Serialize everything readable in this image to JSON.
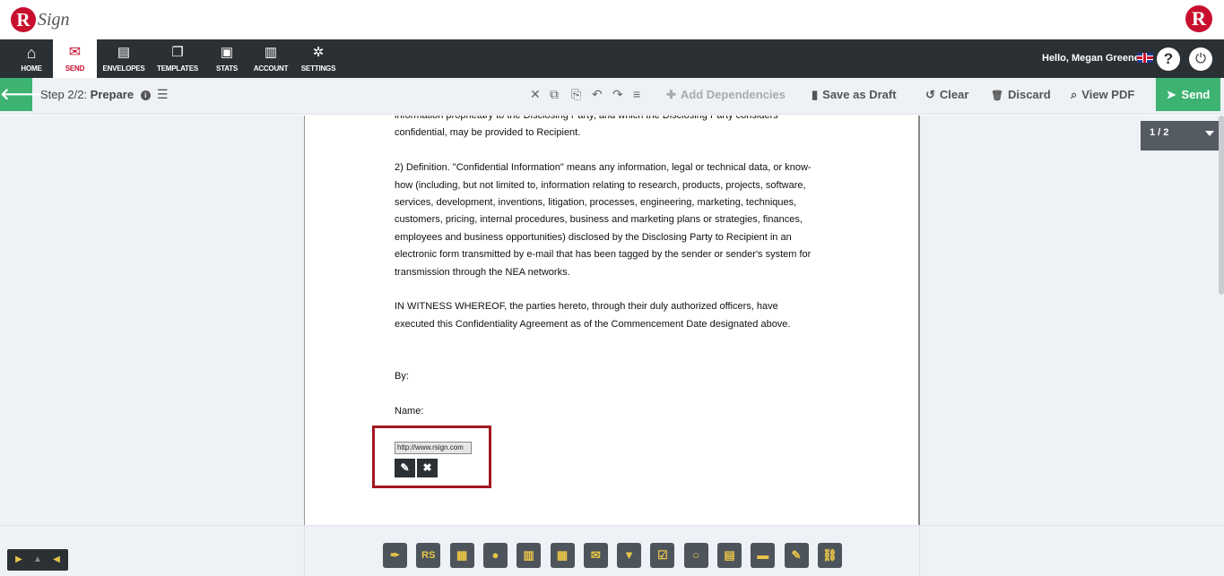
{
  "header": {
    "logo_r": "R",
    "logo_sign": "Sign",
    "brand_r": "R"
  },
  "nav": {
    "items": [
      {
        "label": "HOME",
        "icon": "home-icon",
        "glyph": "⌂"
      },
      {
        "label": "SEND",
        "icon": "envelope-icon",
        "glyph": "✉",
        "active": true
      },
      {
        "label": "ENVELOPES",
        "icon": "inbox-icon",
        "glyph": "▤"
      },
      {
        "label": "TEMPLATES",
        "icon": "copy-icon",
        "glyph": "❐"
      },
      {
        "label": "STATS",
        "icon": "briefcase-icon",
        "glyph": "▣"
      },
      {
        "label": "ACCOUNT",
        "icon": "file-icon",
        "glyph": "▥"
      },
      {
        "label": "SETTINGS",
        "icon": "gear-icon",
        "glyph": "✲"
      }
    ],
    "greeting": "Hello, Megan Greene",
    "help_glyph": "?",
    "power_glyph": "⏻"
  },
  "toolbar": {
    "back_glyph": "🡐",
    "step_prefix": "Step 2/2:",
    "step_name": "Prepare",
    "info_glyph": "i",
    "list_glyph": "☰",
    "icons": {
      "delete": "✕",
      "copy": "⧉",
      "paste": "⎘",
      "undo": "↶",
      "redo": "↷",
      "align": "≡"
    },
    "add_dependencies": "Add Dependencies",
    "save_as_draft": "Save as Draft",
    "clear": "Clear",
    "discard": "Discard",
    "view_pdf": "View PDF",
    "send": "Send",
    "glyphs": {
      "puzzle": "✚",
      "doc": "▮",
      "clear": "↺",
      "trash": "🗑",
      "search": "⌕",
      "plane": "➤"
    }
  },
  "document": {
    "lines": [
      "information proprietary to the Disclosing Party, and which the Disclosing Party considers",
      "confidential, may be provided to Recipient.",
      "",
      "2) Definition.  \"Confidential Information\" means any information, legal or technical data, or know-",
      "how (including, but not limited to, information relating to research, products, projects, software,",
      "services, development, inventions, litigation, processes, engineering, marketing, techniques,",
      "customers, pricing, internal procedures, business and marketing plans or strategies, finances,",
      "employees and business opportunities) disclosed by the Disclosing Party to Recipient in an",
      "electronic form transmitted by e-mail that has been tagged by the sender or sender's system for",
      "transmission through the NEA networks.",
      "",
      "IN WITNESS WHEREOF, the parties hereto, through their duly authorized officers, have",
      "executed this Confidentiality Agreement as of the Commencement Date designated above.",
      "",
      "",
      "By:",
      "",
      "Name:"
    ],
    "field_value": "http://www.rsign.com",
    "edit_glyph": "✎",
    "delete_glyph": "✖"
  },
  "pager": {
    "page_label": "1 / 2"
  },
  "bottom": {
    "controls": [
      "▶",
      "▲",
      "◀"
    ],
    "palette": [
      {
        "name": "signature-tool",
        "glyph": "✒"
      },
      {
        "name": "initials-tool",
        "glyph": "RS"
      },
      {
        "name": "stamp-tool",
        "glyph": "▦"
      },
      {
        "name": "name-tool",
        "glyph": "●"
      },
      {
        "name": "title-tool",
        "glyph": "▥"
      },
      {
        "name": "company-tool",
        "glyph": "▦"
      },
      {
        "name": "email-tool",
        "glyph": "✉"
      },
      {
        "name": "dropdown-tool",
        "glyph": "▼"
      },
      {
        "name": "checkbox-tool",
        "glyph": "☑"
      },
      {
        "name": "radio-tool",
        "glyph": "○"
      },
      {
        "name": "date-tool",
        "glyph": "▤"
      },
      {
        "name": "text-tool",
        "glyph": "▬"
      },
      {
        "name": "label-tool",
        "glyph": "✎"
      },
      {
        "name": "hyperlink-tool",
        "glyph": "⛓"
      }
    ]
  },
  "colors": {
    "brand_red": "#c8102e",
    "nav_dark": "#2b3035",
    "send_green": "#3cb371",
    "highlight_border": "#a31621",
    "palette_icon": "#e8c547"
  }
}
